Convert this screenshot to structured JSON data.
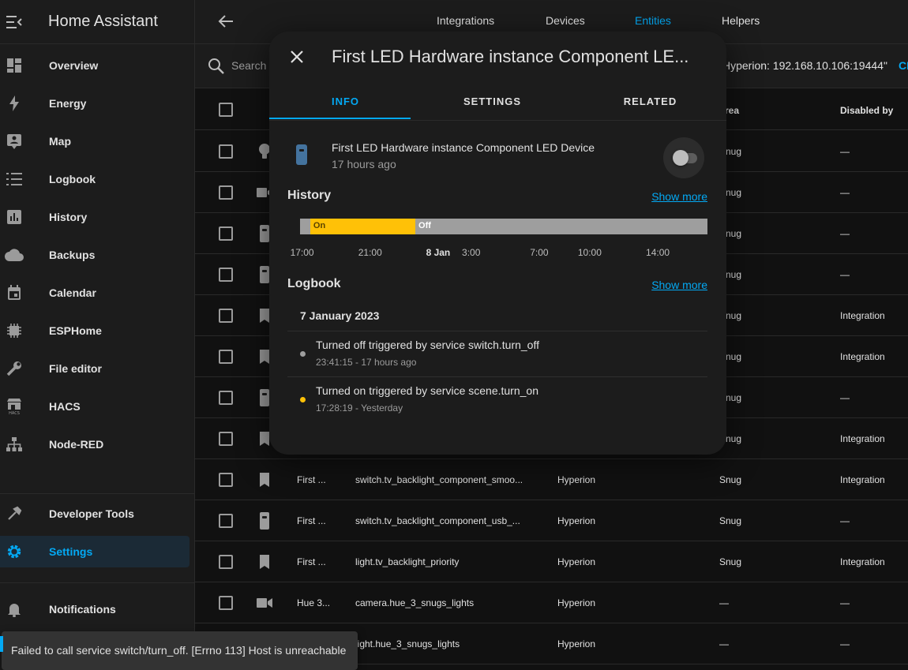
{
  "app": {
    "title": "Home Assistant"
  },
  "sidebar": {
    "items": [
      {
        "label": "Overview",
        "icon": "dashboard-icon"
      },
      {
        "label": "Energy",
        "icon": "lightning-icon"
      },
      {
        "label": "Map",
        "icon": "map-icon"
      },
      {
        "label": "Logbook",
        "icon": "list-icon"
      },
      {
        "label": "History",
        "icon": "chart-icon"
      },
      {
        "label": "Backups",
        "icon": "cloud-icon"
      },
      {
        "label": "Calendar",
        "icon": "calendar-icon"
      },
      {
        "label": "ESPHome",
        "icon": "chip-icon"
      },
      {
        "label": "File editor",
        "icon": "wrench-icon"
      },
      {
        "label": "HACS",
        "icon": "hacs-icon"
      },
      {
        "label": "Node-RED",
        "icon": "sitemap-icon"
      }
    ],
    "developer_tools": "Developer Tools",
    "settings": "Settings",
    "notifications": "Notifications"
  },
  "topbar": {
    "tabs": [
      "Integrations",
      "Devices",
      "Entities",
      "Helpers"
    ],
    "active_tab": "Entities"
  },
  "search": {
    "placeholder": "Search",
    "filter": "Hyperion: 192.168.10.106:19444\"",
    "clear": "CL"
  },
  "table": {
    "headers": {
      "area": "rea",
      "disabled_by": "Disabled by"
    },
    "rows": [
      {
        "icon": "bulb-icon",
        "name": "",
        "entity_id": "",
        "integration": "",
        "area": "Snug",
        "disabled_by": "—"
      },
      {
        "icon": "camera-icon",
        "name": "",
        "entity_id": "",
        "integration": "",
        "area": "Snug",
        "disabled_by": "—"
      },
      {
        "icon": "remote-icon",
        "name": "",
        "entity_id": "",
        "integration": "",
        "area": "Snug",
        "disabled_by": "—"
      },
      {
        "icon": "remote-icon",
        "name": "",
        "entity_id": "",
        "integration": "",
        "area": "Snug",
        "disabled_by": "—"
      },
      {
        "icon": "bookmark-icon",
        "name": "",
        "entity_id": "",
        "integration": "",
        "area": "Snug",
        "disabled_by": "Integration"
      },
      {
        "icon": "bookmark-icon",
        "name": "",
        "entity_id": "",
        "integration": "",
        "area": "Snug",
        "disabled_by": "Integration"
      },
      {
        "icon": "remote-icon",
        "name": "",
        "entity_id": "",
        "integration": "",
        "area": "Snug",
        "disabled_by": "—"
      },
      {
        "icon": "bookmark-icon",
        "name": "",
        "entity_id": "",
        "integration": "",
        "area": "Snug",
        "disabled_by": "Integration"
      },
      {
        "icon": "bookmark-icon",
        "name": "First ...",
        "entity_id": "switch.tv_backlight_component_smoo...",
        "integration": "Hyperion",
        "area": "Snug",
        "disabled_by": "Integration"
      },
      {
        "icon": "remote-icon",
        "name": "First ...",
        "entity_id": "switch.tv_backlight_component_usb_...",
        "integration": "Hyperion",
        "area": "Snug",
        "disabled_by": "—"
      },
      {
        "icon": "bookmark-icon",
        "name": "First ...",
        "entity_id": "light.tv_backlight_priority",
        "integration": "Hyperion",
        "area": "Snug",
        "disabled_by": "Integration"
      },
      {
        "icon": "camera-icon",
        "name": "Hue 3...",
        "entity_id": "camera.hue_3_snugs_lights",
        "integration": "Hyperion",
        "area": "—",
        "disabled_by": "—"
      },
      {
        "icon": "",
        "name": "",
        "entity_id": "light.hue_3_snugs_lights",
        "integration": "Hyperion",
        "area": "—",
        "disabled_by": "—"
      }
    ]
  },
  "dialog": {
    "title": "First LED Hardware instance Component LE...",
    "tabs": [
      "INFO",
      "SETTINGS",
      "RELATED"
    ],
    "active_tab": "INFO",
    "entity": {
      "name": "First LED Hardware instance Component LED Device",
      "last_changed": "17 hours ago",
      "state_on": false
    },
    "history": {
      "title": "History",
      "show_more": "Show more",
      "segments": [
        {
          "label": "",
          "state": "off",
          "from": 0.0,
          "to": 0.025
        },
        {
          "label": "On",
          "state": "on",
          "from": 0.025,
          "to": 0.283
        },
        {
          "label": "Off",
          "state": "off",
          "from": 0.283,
          "to": 1.0
        }
      ],
      "ticks": [
        {
          "label": "17:00",
          "pos": 0.005,
          "bold": false
        },
        {
          "label": "21:00",
          "pos": 0.172,
          "bold": false
        },
        {
          "label": "8 Jan",
          "pos": 0.339,
          "bold": true
        },
        {
          "label": "3:00",
          "pos": 0.42,
          "bold": false
        },
        {
          "label": "7:00",
          "pos": 0.587,
          "bold": false
        },
        {
          "label": "10:00",
          "pos": 0.711,
          "bold": false
        },
        {
          "label": "14:00",
          "pos": 0.878,
          "bold": false
        }
      ]
    },
    "logbook": {
      "title": "Logbook",
      "show_more": "Show more",
      "date": "7 January 2023",
      "entries": [
        {
          "message": "Turned off triggered by service switch.turn_off",
          "when": "23:41:15 - 17 hours ago",
          "state": "off"
        },
        {
          "message": "Turned on triggered by service scene.turn_on",
          "when": "17:28:19 - Yesterday",
          "state": "on"
        }
      ]
    }
  },
  "toast": {
    "message": "Failed to call service switch/turn_off. [Errno 113] Host is unreachable"
  },
  "colors": {
    "accent": "#03a9f4",
    "on": "#ffc107",
    "off": "#9e9e9e"
  }
}
